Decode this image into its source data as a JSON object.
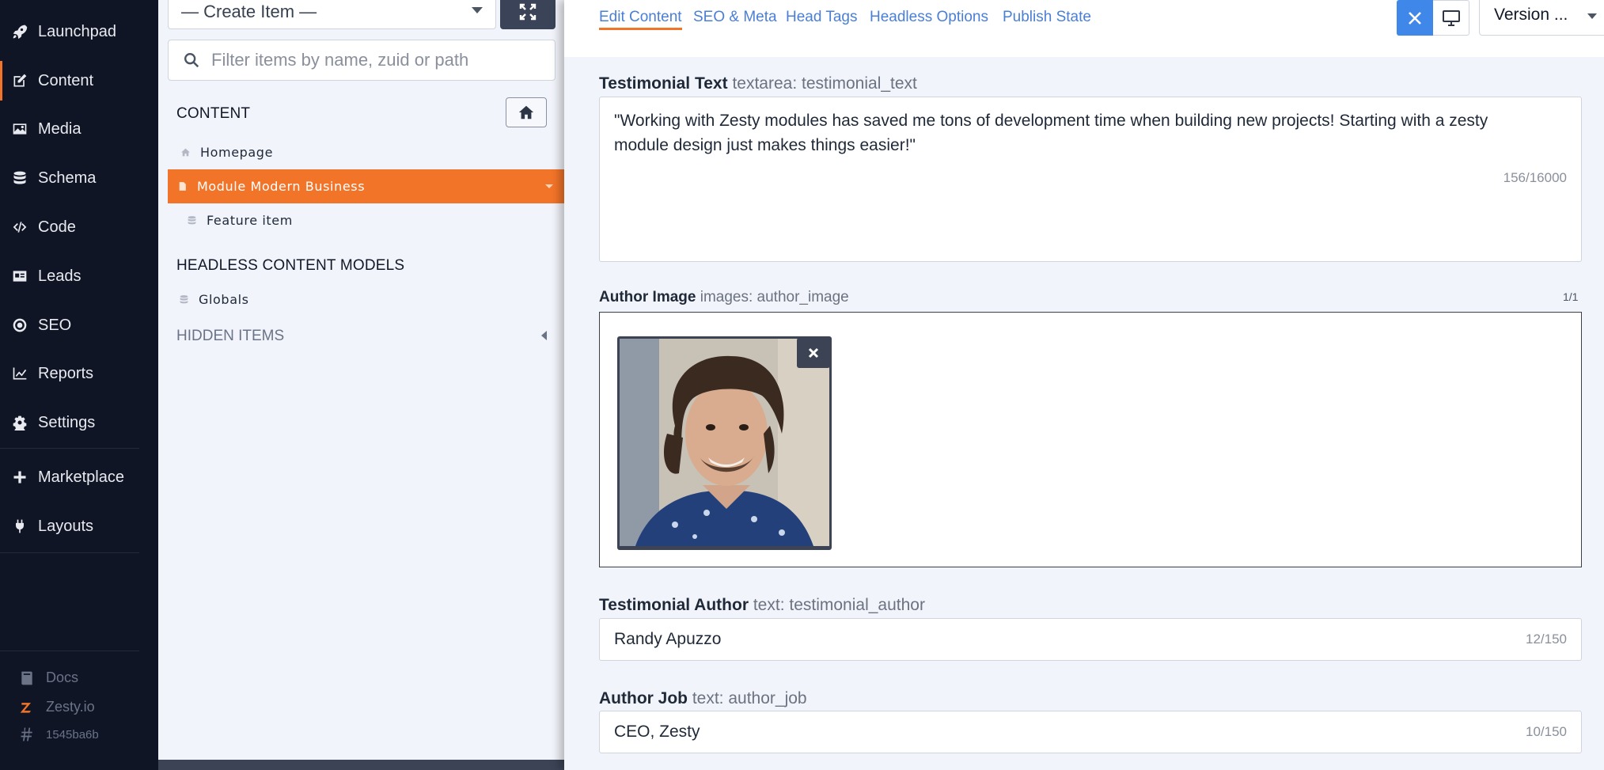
{
  "nav": {
    "items": [
      {
        "label": "Launchpad",
        "icon": "rocket-icon"
      },
      {
        "label": "Content",
        "icon": "edit-icon"
      },
      {
        "label": "Media",
        "icon": "image-icon"
      },
      {
        "label": "Schema",
        "icon": "database-icon"
      },
      {
        "label": "Code",
        "icon": "code-icon"
      },
      {
        "label": "Leads",
        "icon": "address-card-icon"
      },
      {
        "label": "SEO",
        "icon": "target-icon"
      },
      {
        "label": "Reports",
        "icon": "chart-line-icon"
      },
      {
        "label": "Settings",
        "icon": "gear-icon"
      },
      {
        "label": "Marketplace",
        "icon": "plus-icon"
      },
      {
        "label": "Layouts",
        "icon": "plug-icon"
      }
    ],
    "active": "Content",
    "accent_color": "#f27428",
    "footer": {
      "docs": "Docs",
      "brand": "Zesty.io",
      "hash": "1545ba6b"
    }
  },
  "middle": {
    "create_item": "— Create Item —",
    "filter_placeholder": "Filter items by name, zuid or path",
    "content_heading": "CONTENT",
    "tree": [
      {
        "label": "Homepage"
      },
      {
        "label": "Module Modern Business",
        "selected": true
      },
      {
        "label": "Feature item"
      }
    ],
    "headless_heading": "HEADLESS CONTENT MODELS",
    "headless_items": [
      {
        "label": "Globals"
      }
    ],
    "hidden_heading": "HIDDEN ITEMS"
  },
  "editor": {
    "tabs": [
      "Edit Content",
      "SEO & Meta",
      "Head Tags",
      "Headless Options",
      "Publish State"
    ],
    "active_tab": "Edit Content",
    "version_label": "Version ...",
    "fields": {
      "testimonial_text": {
        "label": "Testimonial Text",
        "meta": "textarea: testimonial_text",
        "value": "\"Working with Zesty modules has saved me tons of development time when building new projects! Starting with a zesty module design just makes things easier!\"",
        "counter": "156/16000"
      },
      "author_image": {
        "label": "Author Image",
        "meta": "images: author_image",
        "counter": "1/1"
      },
      "testimonial_author": {
        "label": "Testimonial Author",
        "meta": "text: testimonial_author",
        "value": "Randy Apuzzo",
        "counter": "12/150"
      },
      "author_job": {
        "label": "Author Job",
        "meta": "text: author_job",
        "value": "CEO, Zesty",
        "counter": "10/150"
      }
    }
  }
}
